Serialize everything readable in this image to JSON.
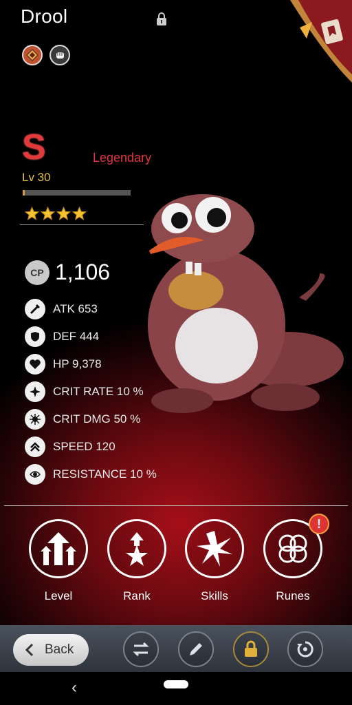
{
  "header": {
    "name": "Drool"
  },
  "grade": "S",
  "rarity": "Legendary",
  "level": "Lv 30",
  "xp_progress": 0.02,
  "stars": 4,
  "cp": {
    "badge": "CP",
    "value": "1,106"
  },
  "stats": [
    {
      "text": "ATK 653",
      "icon": "sword-icon"
    },
    {
      "text": "DEF 444",
      "icon": "shield-icon"
    },
    {
      "text": "HP 9,378",
      "icon": "heart-icon"
    },
    {
      "text": "CRIT RATE 10 %",
      "icon": "crit-rate-icon"
    },
    {
      "text": "CRIT DMG 50 %",
      "icon": "crit-dmg-icon"
    },
    {
      "text": "SPEED 120",
      "icon": "speed-icon"
    },
    {
      "text": "RESISTANCE 10 %",
      "icon": "resistance-icon"
    }
  ],
  "actions": [
    {
      "label": "Level",
      "icon": "level-up-arrows-icon"
    },
    {
      "label": "Rank",
      "icon": "rank-star-icon"
    },
    {
      "label": "Skills",
      "icon": "skills-burst-icon"
    },
    {
      "label": "Runes",
      "icon": "runes-rings-icon",
      "alert": "!"
    }
  ],
  "bottom": {
    "back_label": "Back"
  },
  "colors": {
    "rarity": "#e3343f",
    "level": "#e9c13c",
    "grade": "#e23a3a",
    "star": "#f2c230"
  }
}
